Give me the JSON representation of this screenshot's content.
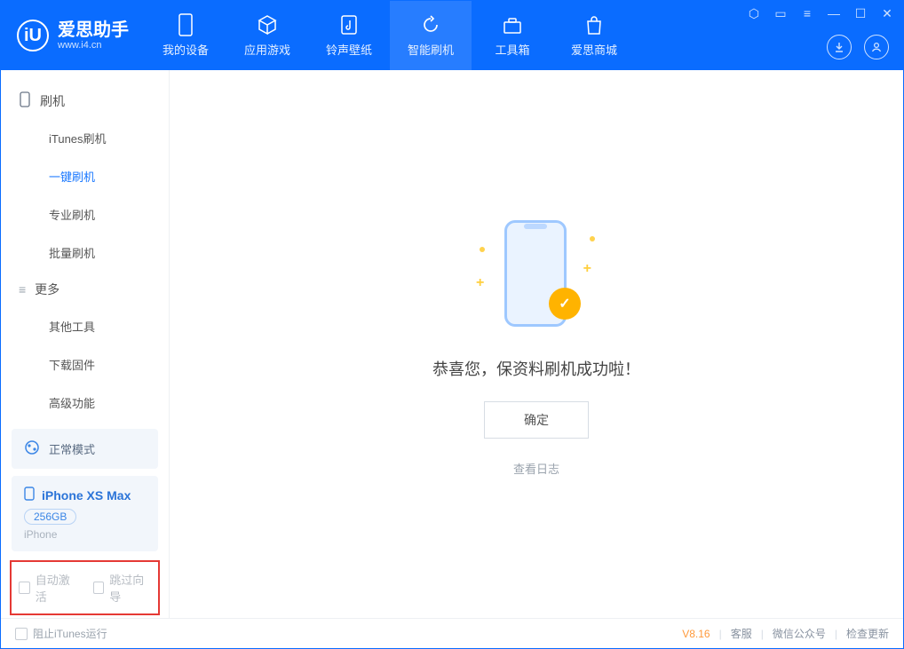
{
  "app": {
    "title": "爱思助手",
    "subtitle": "www.i4.cn"
  },
  "tabs": [
    {
      "label": "我的设备",
      "icon": "device-icon"
    },
    {
      "label": "应用游戏",
      "icon": "cube-icon"
    },
    {
      "label": "铃声壁纸",
      "icon": "music-icon"
    },
    {
      "label": "智能刷机",
      "icon": "refresh-icon"
    },
    {
      "label": "工具箱",
      "icon": "toolbox-icon"
    },
    {
      "label": "爱思商城",
      "icon": "bag-icon"
    }
  ],
  "active_tab_index": 3,
  "sidebar": {
    "groups": [
      {
        "title": "刷机",
        "icon": "phone-icon",
        "items": [
          "iTunes刷机",
          "一键刷机",
          "专业刷机",
          "批量刷机"
        ],
        "active_index": 1
      },
      {
        "title": "更多",
        "icon": "list-icon",
        "items": [
          "其他工具",
          "下载固件",
          "高级功能"
        ]
      }
    ],
    "mode_label": "正常模式",
    "device": {
      "name": "iPhone XS Max",
      "capacity": "256GB",
      "type": "iPhone"
    },
    "options": {
      "auto_activate": "自动激活",
      "skip_guide": "跳过向导"
    }
  },
  "main": {
    "success_text": "恭喜您，保资料刷机成功啦！",
    "ok_button": "确定",
    "view_log": "查看日志"
  },
  "footer": {
    "block_itunes": "阻止iTunes运行",
    "version": "V8.16",
    "links": [
      "客服",
      "微信公众号",
      "检查更新"
    ]
  }
}
